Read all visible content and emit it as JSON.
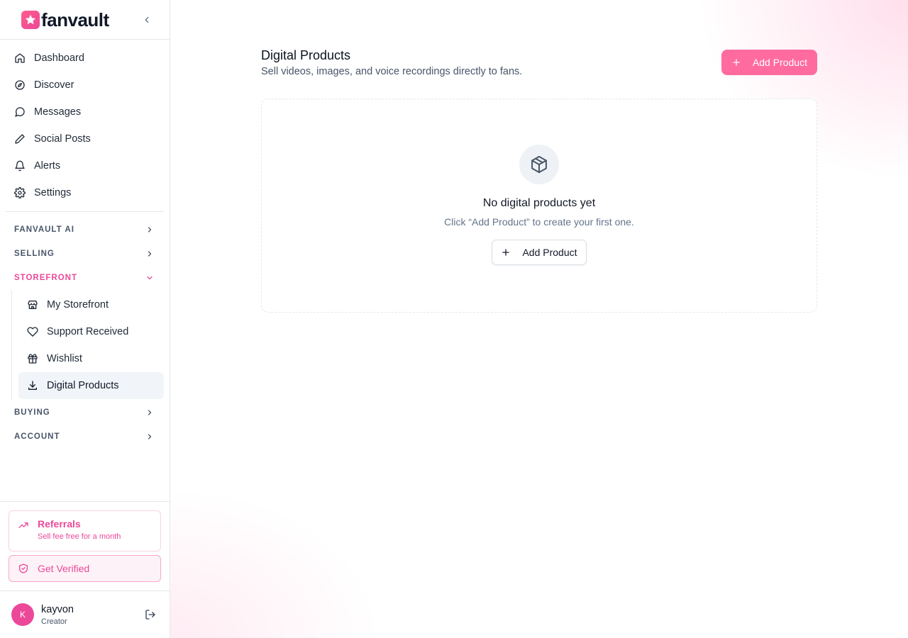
{
  "brand": {
    "name": "fanvault",
    "accent": "#ec4899"
  },
  "sidebar": {
    "nav": [
      {
        "label": "Dashboard",
        "icon": "home-icon"
      },
      {
        "label": "Discover",
        "icon": "compass-icon"
      },
      {
        "label": "Messages",
        "icon": "message-circle-icon"
      },
      {
        "label": "Social Posts",
        "icon": "pen-icon"
      },
      {
        "label": "Alerts",
        "icon": "bell-icon"
      },
      {
        "label": "Settings",
        "icon": "gear-icon"
      }
    ],
    "sections": {
      "ai": "FANVAULT AI",
      "selling": "SELLING",
      "storefront": "STOREFRONT",
      "buying": "BUYING",
      "account": "ACCOUNT"
    },
    "storefront_items": [
      {
        "label": "My Storefront",
        "icon": "store-icon"
      },
      {
        "label": "Support Received",
        "icon": "heart-icon"
      },
      {
        "label": "Wishlist",
        "icon": "gift-icon"
      },
      {
        "label": "Digital Products",
        "icon": "download-icon",
        "selected": true
      }
    ],
    "referrals": {
      "title": "Referrals",
      "subtitle": "Sell fee free for a month"
    },
    "verify": {
      "label": "Get Verified"
    },
    "user": {
      "initial": "K",
      "name": "kayvon",
      "role": "Creator"
    }
  },
  "main": {
    "title": "Digital Products",
    "description": "Sell videos, images, and voice recordings directly to fans.",
    "add_button": "Add Product",
    "empty": {
      "title": "No digital products yet",
      "subtitle": "Click “Add Product” to create your first one.",
      "button": "Add Product"
    }
  },
  "colors": {
    "primary_button": "#ff6b9f",
    "accent": "#ec4899",
    "muted_text": "#475569"
  }
}
